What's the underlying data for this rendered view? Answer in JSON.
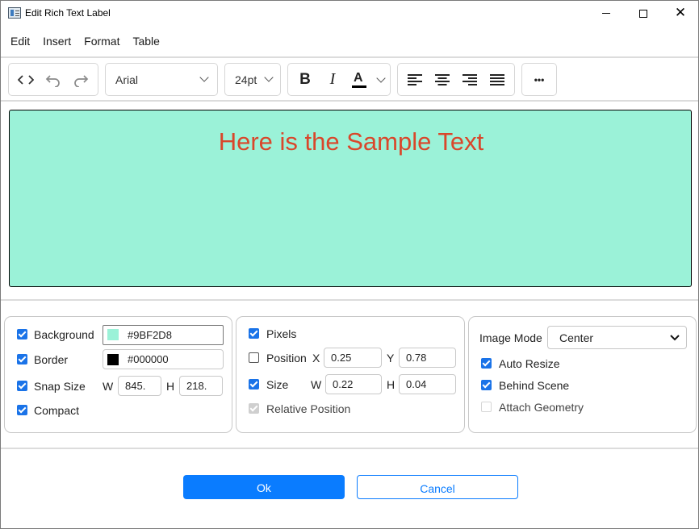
{
  "window": {
    "title": "Edit Rich Text Label"
  },
  "menu": {
    "items": [
      "Edit",
      "Insert",
      "Format",
      "Table"
    ]
  },
  "toolbar": {
    "font_family": "Arial",
    "font_size": "24pt",
    "more_label": "•••",
    "icons": [
      "code-view-icon",
      "undo-icon",
      "redo-icon",
      "bold-icon",
      "italic-icon",
      "text-color-icon",
      "align-left-icon",
      "align-center-icon",
      "align-right-icon",
      "justify-icon",
      "more-icon"
    ],
    "text_color": "#000000"
  },
  "editor": {
    "text": "Here is the Sample Text",
    "background": "#9BF2D8",
    "text_color": "#D9472B"
  },
  "panel_left": {
    "background": {
      "label": "Background",
      "checked": true,
      "value": "#9BF2D8"
    },
    "border": {
      "label": "Border",
      "checked": true,
      "value": "#000000"
    },
    "snap_size": {
      "label": "Snap Size",
      "checked": true,
      "w_label": "W",
      "w_value": "845.",
      "h_label": "H",
      "h_value": "218."
    },
    "compact": {
      "label": "Compact",
      "checked": true
    }
  },
  "panel_mid": {
    "pixels": {
      "label": "Pixels",
      "checked": true
    },
    "position": {
      "label": "Position",
      "checked": false,
      "x_label": "X",
      "x_value": "0.25",
      "y_label": "Y",
      "y_value": "0.78"
    },
    "size": {
      "label": "Size",
      "checked": true,
      "w_label": "W",
      "w_value": "0.22",
      "h_label": "H",
      "h_value": "0.04"
    },
    "relative_position": {
      "label": "Relative Position",
      "checked": true,
      "disabled": true
    }
  },
  "panel_right": {
    "image_mode_label": "Image Mode",
    "image_mode_value": "Center",
    "auto_resize": {
      "label": "Auto Resize",
      "checked": true
    },
    "behind_scene": {
      "label": "Behind Scene",
      "checked": true
    },
    "attach_geometry": {
      "label": "Attach Geometry",
      "checked": false,
      "disabled": true
    }
  },
  "buttons": {
    "ok": "Ok",
    "cancel": "Cancel"
  },
  "colors": {
    "accent": "#0A7CFF",
    "checkbox": "#1A73E8"
  }
}
